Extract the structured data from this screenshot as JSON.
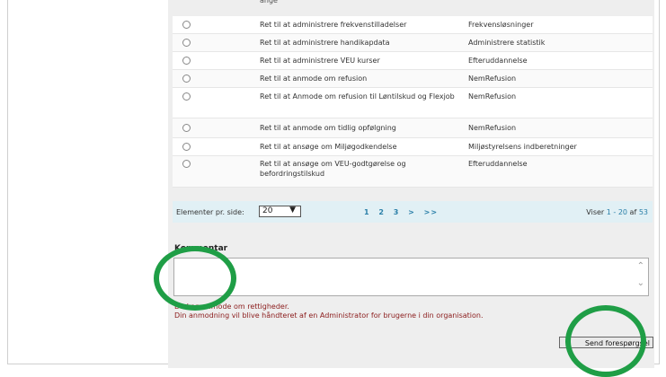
{
  "top_cut_text": "ange",
  "rows": [
    {
      "name": "Ret til at administrere frekvenstilladelser",
      "category": "Frekvensløsninger"
    },
    {
      "name": "Ret til at administrere handikapdata",
      "category": "Administrere statistik"
    },
    {
      "name": "Ret til at administrere VEU kurser",
      "category": "Efteruddannelse"
    },
    {
      "name": "Ret til at anmode om refusion",
      "category": "NemRefusion"
    },
    {
      "name": "Ret til at Anmode om refusion til Løntilskud og Flexjob",
      "category": "NemRefusion"
    },
    {
      "name": "Ret til at anmode om tidlig opfølgning",
      "category": "NemRefusion"
    },
    {
      "name": "Ret til at ansøge om Miljøgodkendelse",
      "category": "Miljøstyrelsens indberetninger"
    },
    {
      "name": "Ret til at ansøge om VEU-godtgørelse og befordringstilskud",
      "category": "Efteruddannelse"
    }
  ],
  "pager": {
    "label": "Elementer pr. side:",
    "page_size": "20",
    "pages": [
      "1",
      "2",
      "3",
      ">",
      ">>"
    ],
    "viser_prefix": "Viser",
    "viser_range": "1 - 20",
    "viser_of": "af",
    "viser_total": "53"
  },
  "comment": {
    "title": "Kommentar",
    "value": ""
  },
  "note": {
    "line1": "Du kan anmode om rettigheder.",
    "line2": "Din anmodning vil blive håndteret af en Administrator for brugerne i din organisation."
  },
  "send_button": "Send forespørgsel",
  "colors": {
    "highlight_circle": "#1f9e46",
    "pager_bg": "#e1f0f5",
    "link": "#2a7fa8",
    "note_text": "#8b1c1c"
  }
}
